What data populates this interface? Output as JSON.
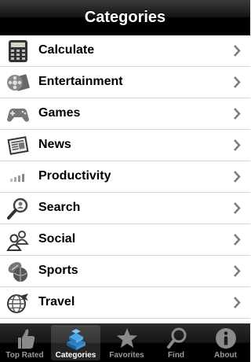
{
  "navbar": {
    "title": "Categories"
  },
  "categories": [
    {
      "label": "Calculate",
      "icon": "calculator-icon"
    },
    {
      "label": "Entertainment",
      "icon": "film-reel-icon"
    },
    {
      "label": "Games",
      "icon": "gamepad-icon"
    },
    {
      "label": "News",
      "icon": "newspaper-icon"
    },
    {
      "label": "Productivity",
      "icon": "bar-chart-icon"
    },
    {
      "label": "Search",
      "icon": "magnifier-person-icon"
    },
    {
      "label": "Social",
      "icon": "people-icon"
    },
    {
      "label": "Sports",
      "icon": "sports-balls-icon"
    },
    {
      "label": "Travel",
      "icon": "globe-plane-icon"
    }
  ],
  "tabbar": {
    "tabs": [
      {
        "label": "Top Rated",
        "icon": "thumbs-up-icon",
        "selected": false
      },
      {
        "label": "Categories",
        "icon": "stacked-boxes-icon",
        "selected": true
      },
      {
        "label": "Favorites",
        "icon": "star-icon",
        "selected": false
      },
      {
        "label": "Find",
        "icon": "magnifier-icon",
        "selected": false
      },
      {
        "label": "About",
        "icon": "info-icon",
        "selected": false
      }
    ]
  },
  "colors": {
    "navbar": "#000000",
    "tab_selected_label": "#ffffff",
    "tab_label": "#999999",
    "tab_selected_icon": "#4aa7e8"
  }
}
